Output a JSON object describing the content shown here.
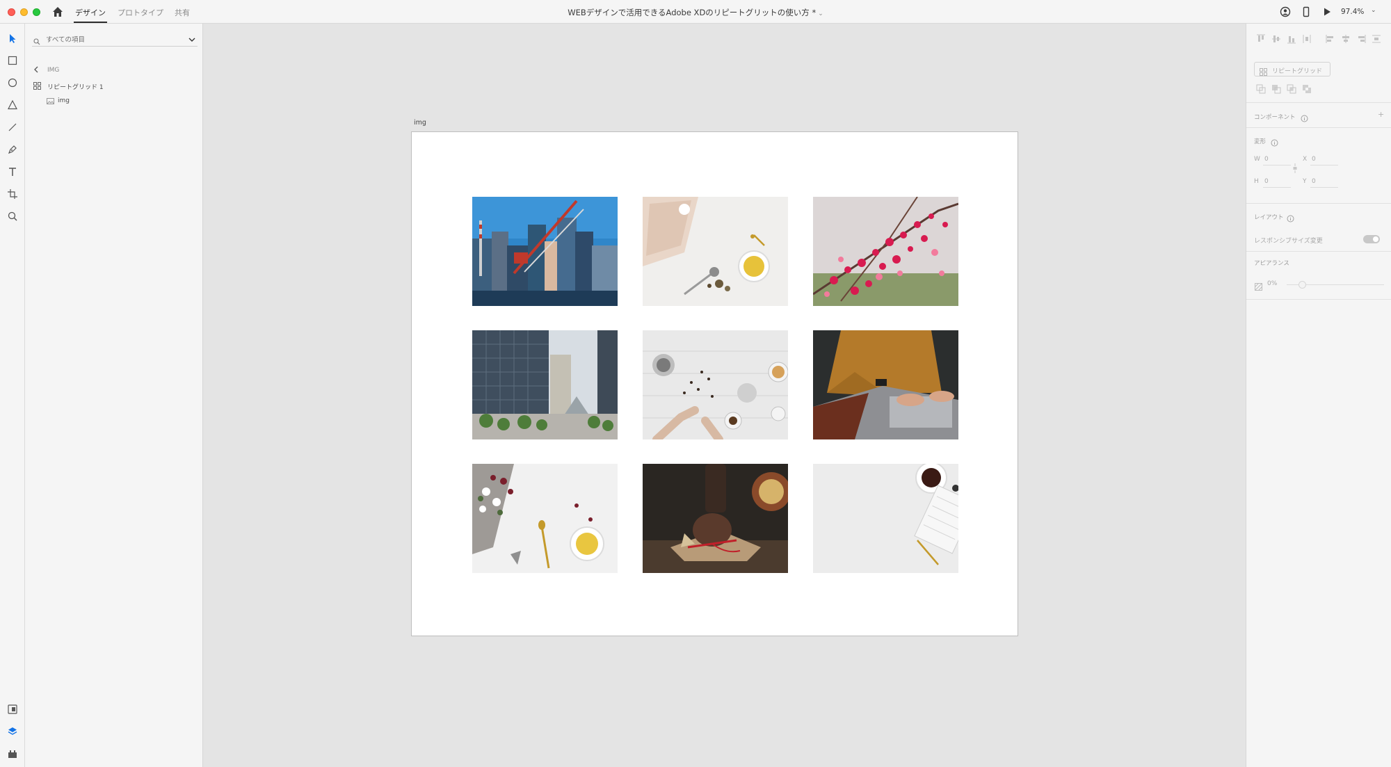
{
  "titlebar": {
    "tabs": [
      "デザイン",
      "プロトタイプ",
      "共有"
    ],
    "active_tab": "デザイン",
    "document_title": "WEBデザインで活用できるAdobe XDのリピートグリットの使い方 *",
    "zoom": "97.4%"
  },
  "layers": {
    "search_placeholder": "すべての項目",
    "breadcrumb": "IMG",
    "items": [
      {
        "label": "リピートグリッド 1",
        "icon": "repeat-grid-icon"
      },
      {
        "label": "img",
        "icon": "image-icon"
      }
    ]
  },
  "canvas": {
    "artboard_label": "img",
    "photos": [
      "city-construction-cranes",
      "tea-cup-and-leaves-on-marble",
      "pink-blossom-branches",
      "glass-office-buildings",
      "tea-brewing-on-white-table",
      "person-typing-on-laptop",
      "flowers-and-yellow-tea",
      "chocolate-muffin-with-ribbon",
      "white-keyboard-and-coffee"
    ]
  },
  "properties": {
    "repeat_grid_label": "リピートグリッド",
    "component_label": "コンポーネント",
    "transform_label": "変形",
    "w_label": "W",
    "w_value": "0",
    "x_label": "X",
    "x_value": "0",
    "h_label": "H",
    "h_value": "0",
    "y_label": "Y",
    "y_value": "0",
    "layout_label": "レイアウト",
    "responsive_label": "レスポンシブサイズ変更",
    "appearance_label": "アピアランス",
    "opacity_value": "0%"
  },
  "colors": {
    "accent": "#1473e6",
    "panel": "#f5f5f5",
    "canvas": "#e4e4e4"
  }
}
